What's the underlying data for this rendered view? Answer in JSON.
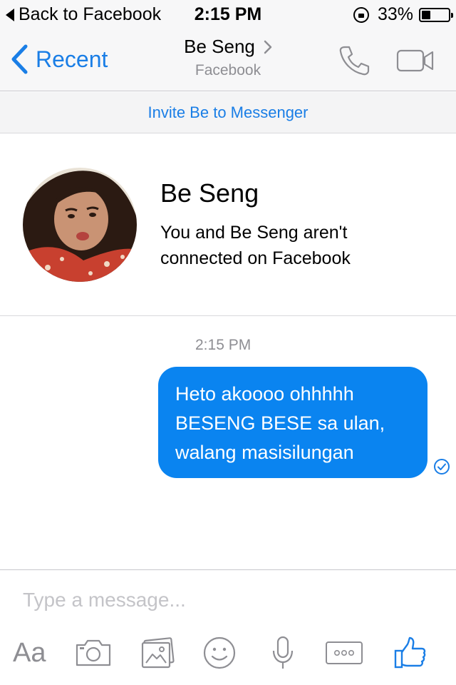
{
  "status_bar": {
    "back_label": "Back to Facebook",
    "time": "2:15 PM",
    "battery": "33%",
    "battery_level": 0.33
  },
  "nav": {
    "back_label": "Recent",
    "contact_name": "Be Seng",
    "contact_source": "Facebook"
  },
  "invite": {
    "label": "Invite Be to Messenger"
  },
  "profile": {
    "name": "Be Seng",
    "connection_text": "You and Be Seng aren't connected on Facebook"
  },
  "conversation": {
    "timestamp": "2:15 PM",
    "messages": [
      {
        "direction": "outgoing",
        "text": "Heto akoooo ohhhhh BESENG BESE sa ulan, walang masisilungan",
        "status": "sent"
      }
    ]
  },
  "composer": {
    "placeholder": "Type a message...",
    "value": "",
    "aa_label": "Aa"
  },
  "colors": {
    "accent": "#1a7ee6",
    "bubble": "#0a84f0",
    "icon_gray": "#8e8e93"
  }
}
